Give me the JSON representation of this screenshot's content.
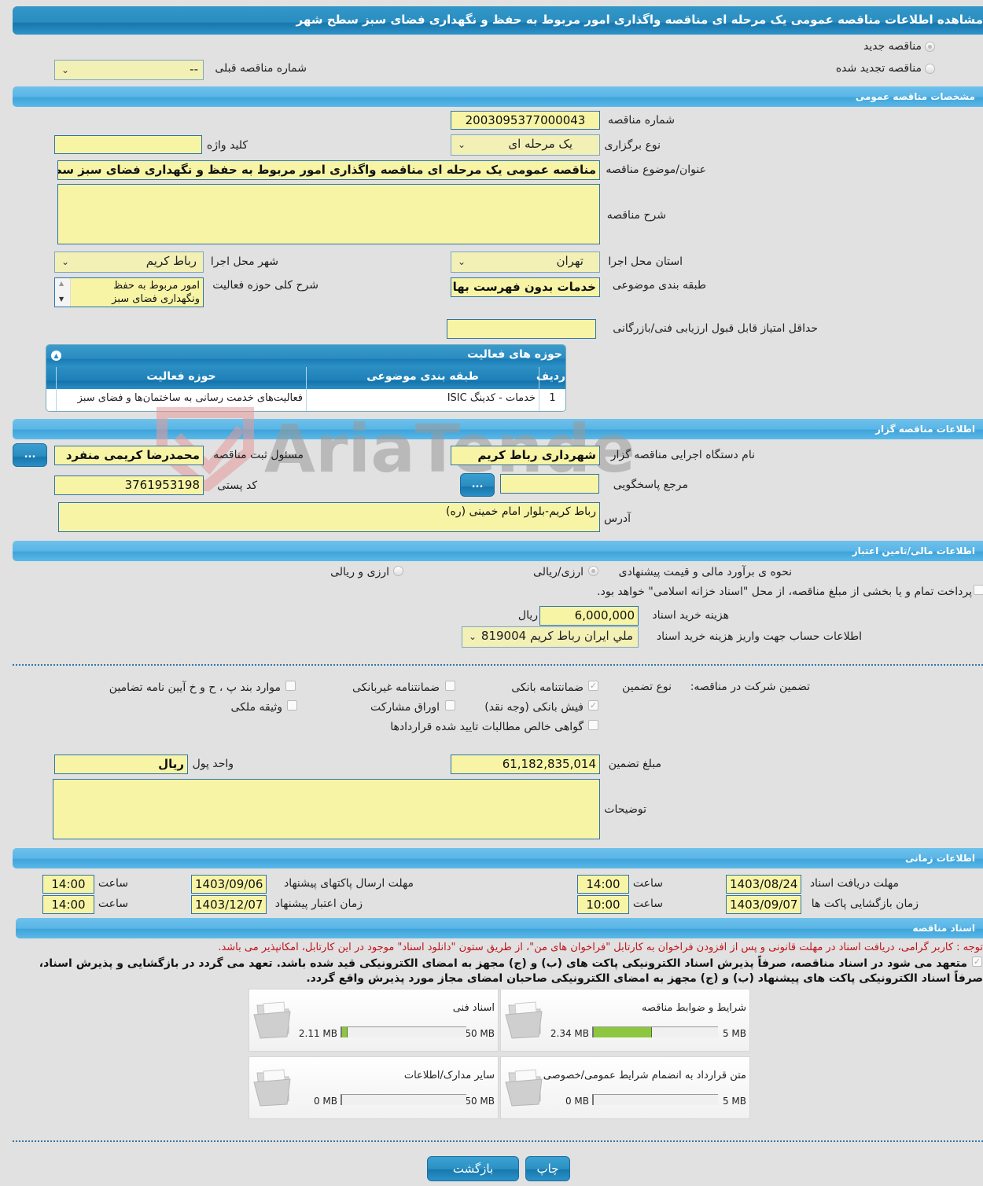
{
  "page": {
    "title": "مشاهده اطلاعات مناقصه عمومی یک مرحله ای مناقصه واگذاری امور مربوط به حفظ و نگهداری فضای سبز سطح شهر"
  },
  "tender_type": {
    "options": [
      {
        "label": "مناقصه جدید",
        "selected": true
      },
      {
        "label": "مناقصه تجدید شده",
        "selected": false
      }
    ],
    "previous_number_label": "شماره مناقصه قبلی",
    "previous_number_value": "--"
  },
  "general": {
    "section_title": "مشخصات مناقصه عمومی",
    "number_label": "شماره مناقصه",
    "number_value": "2003095377000043",
    "holding_type_label": "نوع برگزاری",
    "holding_type_value": "یک مرحله ای",
    "keyword_label": "کلید واژه",
    "keyword_value": "",
    "subject_label": "عنوان/موضوع مناقصه",
    "subject_value": "مناقصه عمومی یک مرحله ای مناقصه واگذاری امور مربوط به حفظ و نگهداری فضای سبز سطح شهر",
    "description_label": "شرح مناقصه",
    "description_value": "",
    "province_label": "استان محل اجرا",
    "province_value": "تهران",
    "city_label": "شهر محل اجرا",
    "city_value": "رباط کریم",
    "category_label": "طبقه بندی موضوعی",
    "category_value": "خدمات بدون فهرست بها",
    "activity_desc_label": "شرح کلی حوزه فعالیت",
    "activity_desc_value": "امور مربوط به حفظ ونگهداری فضای سبز",
    "min_score_label": "حداقل امتیاز قابل قبول ارزیابی فنی/بازرگانی",
    "min_score_value": ""
  },
  "activities": {
    "title": "حوزه های فعالیت",
    "columns": [
      "ردیف",
      "طبقه بندی موضوعی",
      "حوزه فعالیت"
    ],
    "rows": [
      {
        "row": "1",
        "category": "خدمات - کدینگ ISIC",
        "field": "فعالیت‌های خدمت رسانی به ساختمان‌ها و فضای سبز"
      }
    ]
  },
  "organizer": {
    "section_title": "اطلاعات مناقصه گزار",
    "org_label": "نام دستگاه اجرایی مناقصه گزار",
    "org_value": "شهرداری رباط کریم",
    "registrar_label": "مسئول ثبت مناقصه",
    "registrar_value": "محمدرضا کریمی منفرد",
    "reference_label": "مرجع پاسخگویی",
    "reference_value": "",
    "postal_label": "کد پستی",
    "postal_value": "3761953198",
    "address_label": "آدرس",
    "address_value": "رباط کریم-بلوار امام خمینی (ره)",
    "dots_label": "..."
  },
  "finance": {
    "section_title": "اطلاعات مالی/تامین اعتبار",
    "estimate_label": "نحوه ی برآورد مالی و قیمت پیشنهادی",
    "estimate_options": [
      {
        "label": "ارزی/ریالی",
        "selected": true
      },
      {
        "label": "ارزی و ریالی",
        "selected": false
      }
    ],
    "treasury_text": "پرداخت تمام و یا بخشی از مبلغ مناقصه، از محل \"اسناد خزانه اسلامی\" خواهد بود.",
    "treasury_checked": false,
    "doc_cost_label": "هزینه خرید اسناد",
    "doc_cost_value": "6,000,000",
    "doc_cost_unit": "ریال",
    "account_label": "اطلاعات حساب جهت واریز هزینه خرید اسناد",
    "account_value": "ملي ايران رباط کریم 819004"
  },
  "guarantee": {
    "label": "تضمین شرکت در مناقصه:",
    "type_label": "نوع تضمین",
    "options": [
      {
        "label": "ضمانتنامه بانکی",
        "checked": true
      },
      {
        "label": "ضمانتنامه غیربانکی",
        "checked": false
      },
      {
        "label": "موارد بند پ ، ح و خ آیین نامه تضامین",
        "checked": false
      },
      {
        "label": "فیش بانکی (وجه نقد)",
        "checked": true
      },
      {
        "label": "اوراق مشارکت",
        "checked": false
      },
      {
        "label": "وثیقه ملکی",
        "checked": false
      },
      {
        "label": "گواهی خالص مطالبات تایید شده قراردادها",
        "checked": false
      }
    ],
    "amount_label": "مبلغ تضمین",
    "amount_value": "61,182,835,014",
    "currency_label": "واحد پول",
    "currency_value": "ریال",
    "notes_label": "توضیحات",
    "notes_value": ""
  },
  "timing": {
    "section_title": "اطلاعات زمانی",
    "hour_label": "ساعت",
    "doc_deadline_label": "مهلت دریافت اسناد",
    "doc_deadline_date": "1403/08/24",
    "doc_deadline_time": "14:00",
    "submit_deadline_label": "مهلت ارسال پاکتهای پیشنهاد",
    "submit_deadline_date": "1403/09/06",
    "submit_deadline_time": "14:00",
    "opening_label": "زمان بازگشایی پاکت ها",
    "opening_date": "1403/09/07",
    "opening_time": "10:00",
    "validity_label": "زمان اعتبار پیشنهاد",
    "validity_date": "1403/12/07",
    "validity_time": "14:00"
  },
  "documents": {
    "section_title": "اسناد مناقصه",
    "notice": "توجه : کاربر گرامی، دریافت اسناد در مهلت قانونی و پس از افزودن فراخوان به کارتابل \"فراخوان های من\"، از طریق ستون \"دانلود اسناد\" موجود در این کارتابل، امکانپذیر می باشد.",
    "commitment_line1": "متعهد می شود در اسناد مناقصه، صرفاً پذیرش اسناد الکترونیکی پاکت های (ب) و (ج) مجهز به امضای الکترونیکی قید شده باشد. تعهد می گردد در بازگشایی و پذیرش اسناد،",
    "commitment_line2": "صرفاً اسناد الکترونیکی پاکت های پیشنهاد (ب) و (ج) مجهز به امضای الکترونیکی صاحبان امضای مجاز مورد پذیرش واقع گردد.",
    "commitment_checked": true,
    "files": [
      {
        "title": "شرایط و ضوابط مناقصه",
        "current": "2.34 MB",
        "max": "5 MB",
        "fraction": 0.468
      },
      {
        "title": "اسناد فنی",
        "current": "2.11 MB",
        "max": "50 MB",
        "fraction": 0.042
      },
      {
        "title": "متن قرارداد به انضمام شرایط عمومی/خصوصی",
        "current": "0 MB",
        "max": "5 MB",
        "fraction": 0
      },
      {
        "title": "سایر مدارک/اطلاعات",
        "current": "0 MB",
        "max": "50 MB",
        "fraction": 0
      }
    ]
  },
  "actions": {
    "print_label": "چاپ",
    "back_label": "بازگشت"
  },
  "watermark": {
    "text": "AriaTender.neT"
  }
}
